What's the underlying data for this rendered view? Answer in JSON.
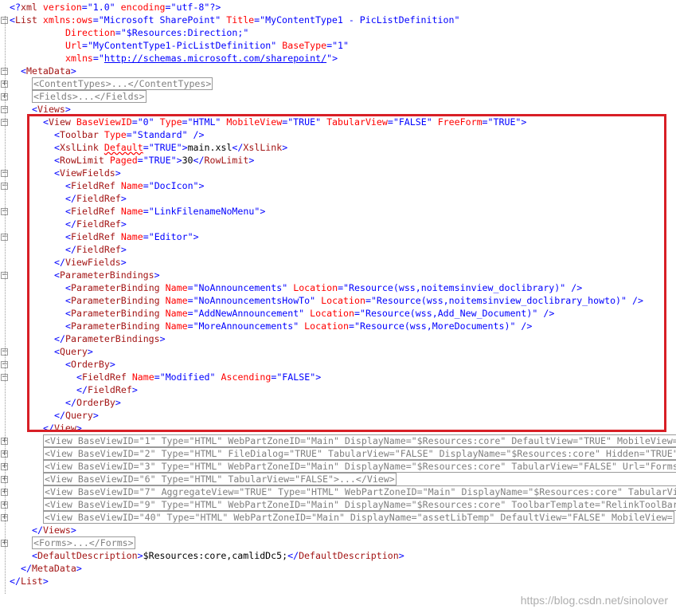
{
  "watermark": "https://blog.csdn.net/sinolover",
  "colors": {
    "bracket": "#0000ff",
    "element": "#a31515",
    "attribute": "#ff0000",
    "value": "#0000ff",
    "highlight_border": "#d81f26"
  },
  "lines": [
    {
      "indent": 0,
      "text": "<?xml version=\"1.0\" encoding=\"utf-8\"?>"
    },
    {
      "indent": 0,
      "text": "<List xmlns:ows=\"Microsoft SharePoint\" Title=\"MyContentType1 - PicListDefinition\""
    },
    {
      "indent": 5,
      "text": "Direction=\"$Resources:Direction;\""
    },
    {
      "indent": 5,
      "text": "Url=\"MyContentType1-PicListDefinition\" BaseType=\"1\""
    },
    {
      "indent": 5,
      "text": "xmlns=\"http://schemas.microsoft.com/sharepoint/\">"
    },
    {
      "indent": 1,
      "text": "<MetaData>"
    },
    {
      "indent": 2,
      "text": "<ContentTypes>...</ContentTypes>"
    },
    {
      "indent": 2,
      "text": "<Fields>...</Fields>"
    },
    {
      "indent": 2,
      "text": "<Views>"
    },
    {
      "indent": 3,
      "text": "<View BaseViewID=\"0\" Type=\"HTML\" MobileView=\"TRUE\" TabularView=\"FALSE\" FreeForm=\"TRUE\">"
    },
    {
      "indent": 4,
      "text": "<Toolbar Type=\"Standard\" />"
    },
    {
      "indent": 4,
      "text": "<XslLink Default=\"TRUE\">main.xsl</XslLink>"
    },
    {
      "indent": 4,
      "text": "<RowLimit Paged=\"TRUE\">30</RowLimit>"
    },
    {
      "indent": 4,
      "text": "<ViewFields>"
    },
    {
      "indent": 5,
      "text": "<FieldRef Name=\"DocIcon\">"
    },
    {
      "indent": 5,
      "text": "</FieldRef>"
    },
    {
      "indent": 5,
      "text": "<FieldRef Name=\"LinkFilenameNoMenu\">"
    },
    {
      "indent": 5,
      "text": "</FieldRef>"
    },
    {
      "indent": 5,
      "text": "<FieldRef Name=\"Editor\">"
    },
    {
      "indent": 5,
      "text": "</FieldRef>"
    },
    {
      "indent": 4,
      "text": "</ViewFields>"
    },
    {
      "indent": 4,
      "text": "<ParameterBindings>"
    },
    {
      "indent": 5,
      "text": "<ParameterBinding Name=\"NoAnnouncements\" Location=\"Resource(wss,noitemsinview_doclibrary)\" />"
    },
    {
      "indent": 5,
      "text": "<ParameterBinding Name=\"NoAnnouncementsHowTo\" Location=\"Resource(wss,noitemsinview_doclibrary_howto)\" />"
    },
    {
      "indent": 5,
      "text": "<ParameterBinding Name=\"AddNewAnnouncement\" Location=\"Resource(wss,Add_New_Document)\" />"
    },
    {
      "indent": 5,
      "text": "<ParameterBinding Name=\"MoreAnnouncements\" Location=\"Resource(wss,MoreDocuments)\" />"
    },
    {
      "indent": 4,
      "text": "</ParameterBindings>"
    },
    {
      "indent": 4,
      "text": "<Query>"
    },
    {
      "indent": 5,
      "text": "<OrderBy>"
    },
    {
      "indent": 6,
      "text": "<FieldRef Name=\"Modified\" Ascending=\"FALSE\">"
    },
    {
      "indent": 6,
      "text": "</FieldRef>"
    },
    {
      "indent": 5,
      "text": "</OrderBy>"
    },
    {
      "indent": 4,
      "text": "</Query>"
    },
    {
      "indent": 3,
      "text": "</View>"
    },
    {
      "indent": 3,
      "text": "<View BaseViewID=\"1\" Type=\"HTML\" WebPartZoneID=\"Main\" DisplayName=\"$Resources:core\" DefaultView=\"TRUE\" MobileView="
    },
    {
      "indent": 3,
      "text": "<View BaseViewID=\"2\" Type=\"HTML\" FileDialog=\"TRUE\" TabularView=\"FALSE\" DisplayName=\"$Resources:core\" Hidden=\"TRUE\""
    },
    {
      "indent": 3,
      "text": "<View BaseViewID=\"3\" Type=\"HTML\" WebPartZoneID=\"Main\" DisplayName=\"$Resources:core\" TabularView=\"FALSE\" Url=\"Forms"
    },
    {
      "indent": 3,
      "text": "<View BaseViewID=\"6\" Type=\"HTML\" TabularView=\"FALSE\">...</View>"
    },
    {
      "indent": 3,
      "text": "<View BaseViewID=\"7\" AggregateView=\"TRUE\" Type=\"HTML\" WebPartZoneID=\"Main\" DisplayName=\"$Resources:core\" TabularVi"
    },
    {
      "indent": 3,
      "text": "<View BaseViewID=\"9\" Type=\"HTML\" WebPartZoneID=\"Main\" DisplayName=\"$Resources:core\" ToolbarTemplate=\"RelinkToolBar"
    },
    {
      "indent": 3,
      "text": "<View BaseViewID=\"40\" Type=\"HTML\" WebPartZoneID=\"Main\" DisplayName=\"assetLibTemp\" DefaultView=\"FALSE\" MobileView="
    },
    {
      "indent": 2,
      "text": "</Views>"
    },
    {
      "indent": 2,
      "text": "<Forms>...</Forms>"
    },
    {
      "indent": 2,
      "text": "<DefaultDescription>$Resources:core,camlidDc5;</DefaultDescription>"
    },
    {
      "indent": 1,
      "text": "</MetaData>"
    },
    {
      "indent": 0,
      "text": "</List>"
    }
  ]
}
